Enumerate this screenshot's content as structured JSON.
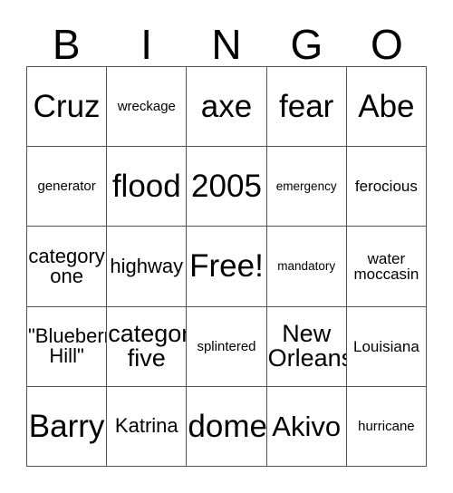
{
  "card": {
    "title": "BINGO",
    "header_letters": [
      "B",
      "I",
      "N",
      "G",
      "O"
    ],
    "grid_size": "5x5",
    "free_space_label": "Free!",
    "colors": {
      "background": "#ffffff",
      "text": "#000000",
      "grid_line": "#555555"
    },
    "rows": [
      [
        {
          "text": "Cruz",
          "size": "xxl"
        },
        {
          "text": "wreckage",
          "size": "xs"
        },
        {
          "text": "axe",
          "size": "xxl"
        },
        {
          "text": "fear",
          "size": "xxl"
        },
        {
          "text": "Abe",
          "size": "xxl"
        }
      ],
      [
        {
          "text": "generator",
          "size": "xs"
        },
        {
          "text": "flood",
          "size": "xxl"
        },
        {
          "text": "2005",
          "size": "xxl"
        },
        {
          "text": "emergency",
          "size": "xxs"
        },
        {
          "text": "ferocious",
          "size": "sm"
        }
      ],
      [
        {
          "text": "category\none",
          "size": "md"
        },
        {
          "text": "highway",
          "size": "md"
        },
        {
          "text": "Free!",
          "size": "xxl"
        },
        {
          "text": "mandatory",
          "size": "xxs"
        },
        {
          "text": "water\nmoccasin",
          "size": "sm"
        }
      ],
      [
        {
          "text": "\"Blueberry\nHill\"",
          "size": "md"
        },
        {
          "text": "category\nfive",
          "size": "lg"
        },
        {
          "text": "splintered",
          "size": "xs"
        },
        {
          "text": "New\nOrleans",
          "size": "lg"
        },
        {
          "text": "Louisiana",
          "size": "sm"
        }
      ],
      [
        {
          "text": "Barry",
          "size": "xxl"
        },
        {
          "text": "Katrina",
          "size": "md"
        },
        {
          "text": "dome",
          "size": "xxl"
        },
        {
          "text": "Akivo",
          "size": "xl"
        },
        {
          "text": "hurricane",
          "size": "xs"
        }
      ]
    ]
  }
}
